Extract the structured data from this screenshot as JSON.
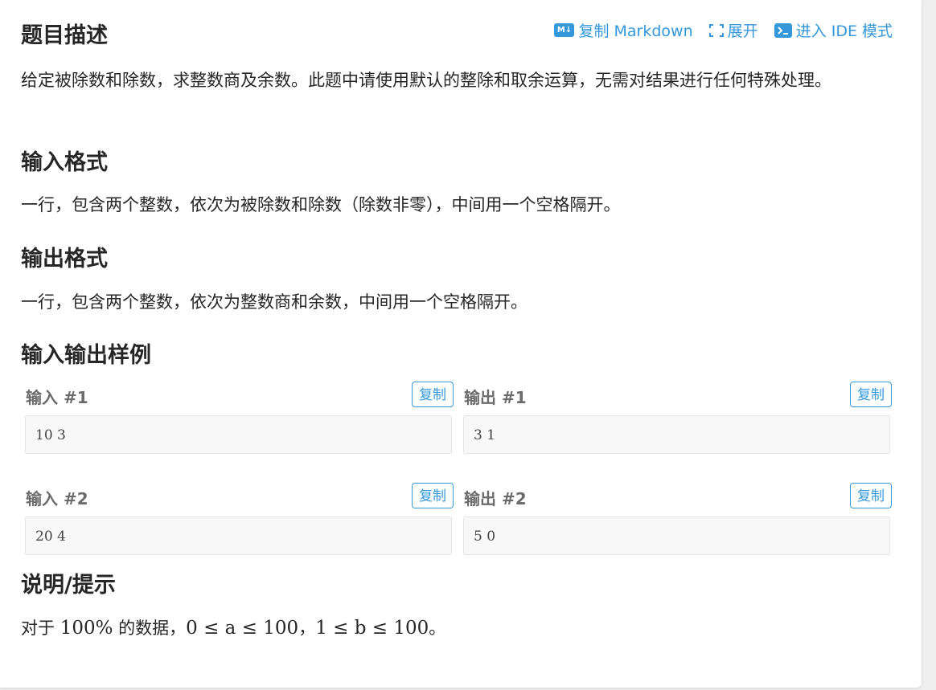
{
  "toolbar": {
    "markdown_icon": "M↓",
    "copy_markdown": "复制 Markdown",
    "expand": "展开",
    "ide": "进入 IDE 模式"
  },
  "sections": {
    "description_title": "题目描述",
    "description_text": "给定被除数和除数，求整数商及余数。此题中请使用默认的整除和取余运算，无需对结果进行任何特殊处理。",
    "input_title": "输入格式",
    "input_text": "一行，包含两个整数，依次为被除数和除数（除数非零），中间用一个空格隔开。",
    "output_title": "输出格式",
    "output_text": "一行，包含两个整数，依次为整数商和余数，中间用一个空格隔开。",
    "samples_title": "输入输出样例",
    "hint_title": "说明/提示",
    "hint_prefix": "对于",
    "hint_percent": "100%",
    "hint_mid": "的数据，",
    "hint_cond_a": "0 ≤ a ≤ 100",
    "hint_sep": "，",
    "hint_cond_b": "1 ≤ b ≤ 100",
    "hint_end": "。"
  },
  "samples": [
    {
      "input_label": "输入 #1",
      "input_value": "10 3",
      "output_label": "输出 #1",
      "output_value": "3 1",
      "copy_label": "复制"
    },
    {
      "input_label": "输入 #2",
      "input_value": "20 4",
      "output_label": "输出 #2",
      "output_value": "5 0",
      "copy_label": "复制"
    }
  ],
  "colors": {
    "accent": "#3498db",
    "code_bg": "#f8f8f8"
  }
}
